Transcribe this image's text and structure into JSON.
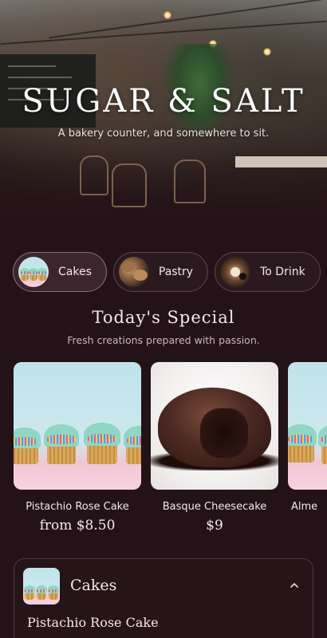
{
  "hero": {
    "title": "SUGAR & SALT",
    "subtitle": "A bakery counter, and somewhere to sit."
  },
  "categories": [
    {
      "label": "Cakes",
      "icon": "cupcakes-thumbnail",
      "active": true
    },
    {
      "label": "Pastry",
      "icon": "pastry-thumbnail",
      "active": false
    },
    {
      "label": "To Drink",
      "icon": "drink-thumbnail",
      "active": false
    }
  ],
  "special": {
    "title": "Today's Special",
    "subtitle": "Fresh creations prepared with passion.",
    "items": [
      {
        "name": "Pistachio Rose Cake",
        "price": "from $8.50"
      },
      {
        "name": "Basque Cheesecake",
        "price": "$9"
      },
      {
        "name": "Alme",
        "price": ""
      }
    ]
  },
  "category_panel": {
    "title": "Cakes",
    "expanded": true,
    "first_item": "Pistachio Rose Cake"
  },
  "colors": {
    "background": "#231217",
    "pill_border": "#5c464b",
    "text": "#f4e9ea"
  }
}
